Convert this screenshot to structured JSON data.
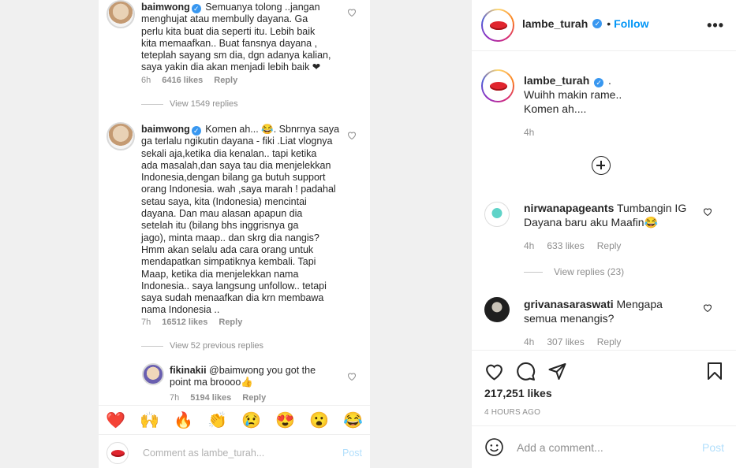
{
  "left": {
    "comment1": {
      "user": "baimwong",
      "text": "Semuanya tolong ..jangan menghujat atau membully dayana. Ga perlu kita buat dia seperti itu. Lebih baik kita memaafkan.. Buat fansnya dayana , teteplah sayang sm dia, dgn adanya kalian, saya yakin dia akan menjadi lebih baik ❤",
      "lines": [
        "Semuanya tolong ..jangan",
        "menghujat atau membully dayana. Ga",
        "perlu kita buat dia seperti itu. Lebih baik",
        "kita memaafkan.. Buat fansnya dayana ,",
        "teteplah sayang sm dia, dgn adanya kalian,",
        "saya yakin dia akan menjadi lebih baik ❤"
      ],
      "time": "6h",
      "likes": "6416 likes",
      "reply": "Reply",
      "view_replies": "View 1549 replies"
    },
    "comment2": {
      "user": "baimwong",
      "lines": [
        "Komen ah... 😂. Sbnrnya saya",
        "ga terlalu ngikutin dayana - fiki .Liat vlognya",
        "sekali aja,ketika dia kenalan.. tapi ketika",
        "ada masalah,dan saya tau  dia menjelekkan",
        "Indonesia,dengan bilang ga butuh support",
        "orang Indonesia. wah ,saya marah ! padahal",
        "setau saya, kita (Indonesia)  mencintai",
        "dayana. Dan mau alasan apapun dia",
        "setelah itu (bilang bhs inggrisnya ga",
        "jago), minta maap.. dan skrg dia nangis?",
        "Hmm akan selalu ada cara orang untuk",
        "mendapatkan simpatiknya kembali. Tapi",
        "Maap, ketika dia menjelekkan nama",
        "Indonesia.. saya langsung unfollow.. tetapi",
        "saya sudah menaafkan dia krn membawa",
        "nama Indonesia .."
      ],
      "time": "7h",
      "likes": "16512 likes",
      "reply": "Reply",
      "view_replies": "View 52 previous replies"
    },
    "reply1": {
      "user": "fikinakii",
      "lines": [
        "@baimwong you got the",
        "point ma broooo👍"
      ],
      "time": "7h",
      "likes": "5194 likes",
      "reply": "Reply"
    },
    "emojis": [
      "❤️",
      "🙌",
      "🔥",
      "👏",
      "😢",
      "😍",
      "😮",
      "😂"
    ],
    "comment_placeholder": "Comment as lambe_turah...",
    "post_label": "Post"
  },
  "panel": {
    "header": {
      "username": "lambe_turah",
      "follow": "Follow",
      "more": "•••"
    },
    "caption": {
      "username": "lambe_turah",
      "suffix": ".",
      "line1": "Wuihh makin rame..",
      "line2": "Komen ah....",
      "time": "4h"
    },
    "comments": [
      {
        "user": "nirwanapageants",
        "line1": "Tumbangin IG",
        "line2": "Dayana baru aku Maafin😂",
        "time": "4h",
        "likes": "633 likes",
        "reply": "Reply",
        "view_replies": "View replies (23)"
      },
      {
        "user": "grivanasaraswati",
        "line1": "Mengapa",
        "line2": "semua menangis?",
        "time": "4h",
        "likes": "307 likes",
        "reply": "Reply"
      }
    ],
    "likes_count": "217,251 likes",
    "timestamp": "4 HOURS AGO",
    "add_comment_placeholder": "Add a comment...",
    "post_label": "Post"
  },
  "colors": {
    "accent": "#0095f6",
    "verified": "#3897f0",
    "muted": "#8e8e8e",
    "post_disabled": "#b2dffc"
  }
}
